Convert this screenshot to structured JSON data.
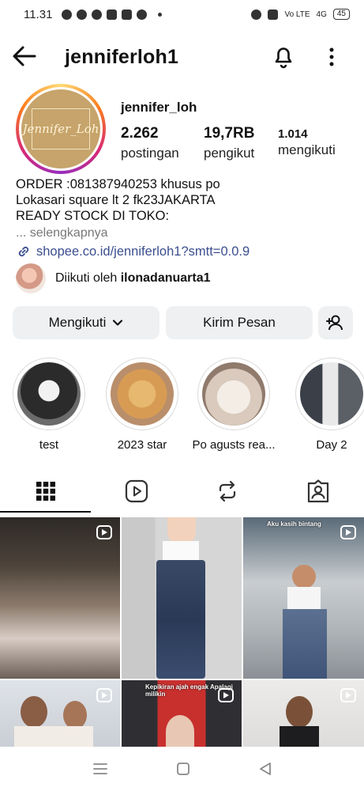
{
  "status_bar": {
    "time": "11.31",
    "network": "Vo LTE",
    "signal": "4G",
    "battery": "45"
  },
  "header": {
    "title": "jenniferloh1"
  },
  "profile": {
    "avatar_text": "Jennifer_Loh",
    "display_name": "jennifer_loh",
    "stats": {
      "posts_count": "2.262",
      "posts_label": "postingan",
      "followers_count": "19,7RB",
      "followers_label": "pengikut",
      "following_count": "1.014",
      "following_label": "mengikuti"
    },
    "bio_lines": [
      "ORDER :081387940253 khusus po",
      "Lokasari square lt 2 fk23JAKARTA",
      "READY STOCK DI TOKO:"
    ],
    "more_label": "... selengkapnya",
    "link": "shopee.co.id/jenniferloh1?smtt=0.0.9",
    "followed_by_prefix": "Diikuti oleh ",
    "followed_by_name": "ilonadanuarta1"
  },
  "actions": {
    "following_label": "Mengikuti",
    "message_label": "Kirim Pesan"
  },
  "highlights": [
    {
      "label": "test"
    },
    {
      "label": "2023 star"
    },
    {
      "label": "Po agusts rea..."
    },
    {
      "label": "Day 2"
    }
  ],
  "tabs": [
    "grid-icon",
    "reels-icon",
    "repost-icon",
    "tagged-icon"
  ],
  "grid_posts": [
    {
      "type": "reel"
    },
    {
      "type": "photo"
    },
    {
      "type": "reel",
      "caption": "Aku kasih bintang"
    },
    {
      "type": "reel"
    },
    {
      "type": "reel",
      "caption": "Kepikiran ajah engak Apalagi milikin"
    },
    {
      "type": "reel"
    }
  ],
  "colors": {
    "link_blue": "#3b4e8f",
    "button_bg": "#eef0f2",
    "avatar_gold": "#c6a46b"
  }
}
